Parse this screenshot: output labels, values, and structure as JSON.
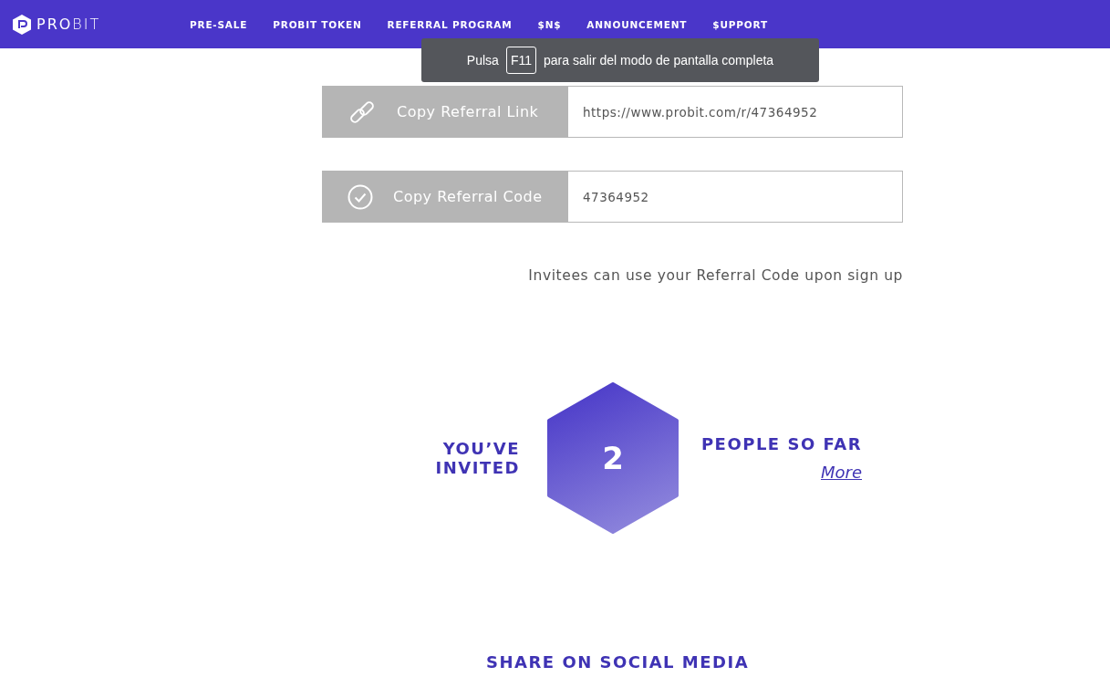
{
  "header": {
    "logo": "**PRO**BIT",
    "nav": [
      "PRE-SALE",
      "PROBIT TOKEN",
      "REFERRAL PROGRAM",
      "$N$",
      "ANNOUNCEMENT",
      "$UPPORT"
    ]
  },
  "fullscreen_notice": {
    "before": "Pulsa",
    "key": "F11",
    "after": "para salir del modo de pantalla completa"
  },
  "referral_rows": [
    {
      "kind": "link",
      "button": "Copy Referral Link",
      "value": "https://www.probit.com/r/47364952"
    },
    {
      "kind": "code",
      "button": "Copy Referral Code",
      "value": "47364952"
    }
  ],
  "hint": "Invitees can use your Referral Code upon sign up",
  "invited": {
    "before": "YOU’VE INVITED",
    "count": "2",
    "after": "PEOPLE SO FAR",
    "more": "More"
  },
  "share_title": "SHARE ON SOCIAL MEDIA"
}
